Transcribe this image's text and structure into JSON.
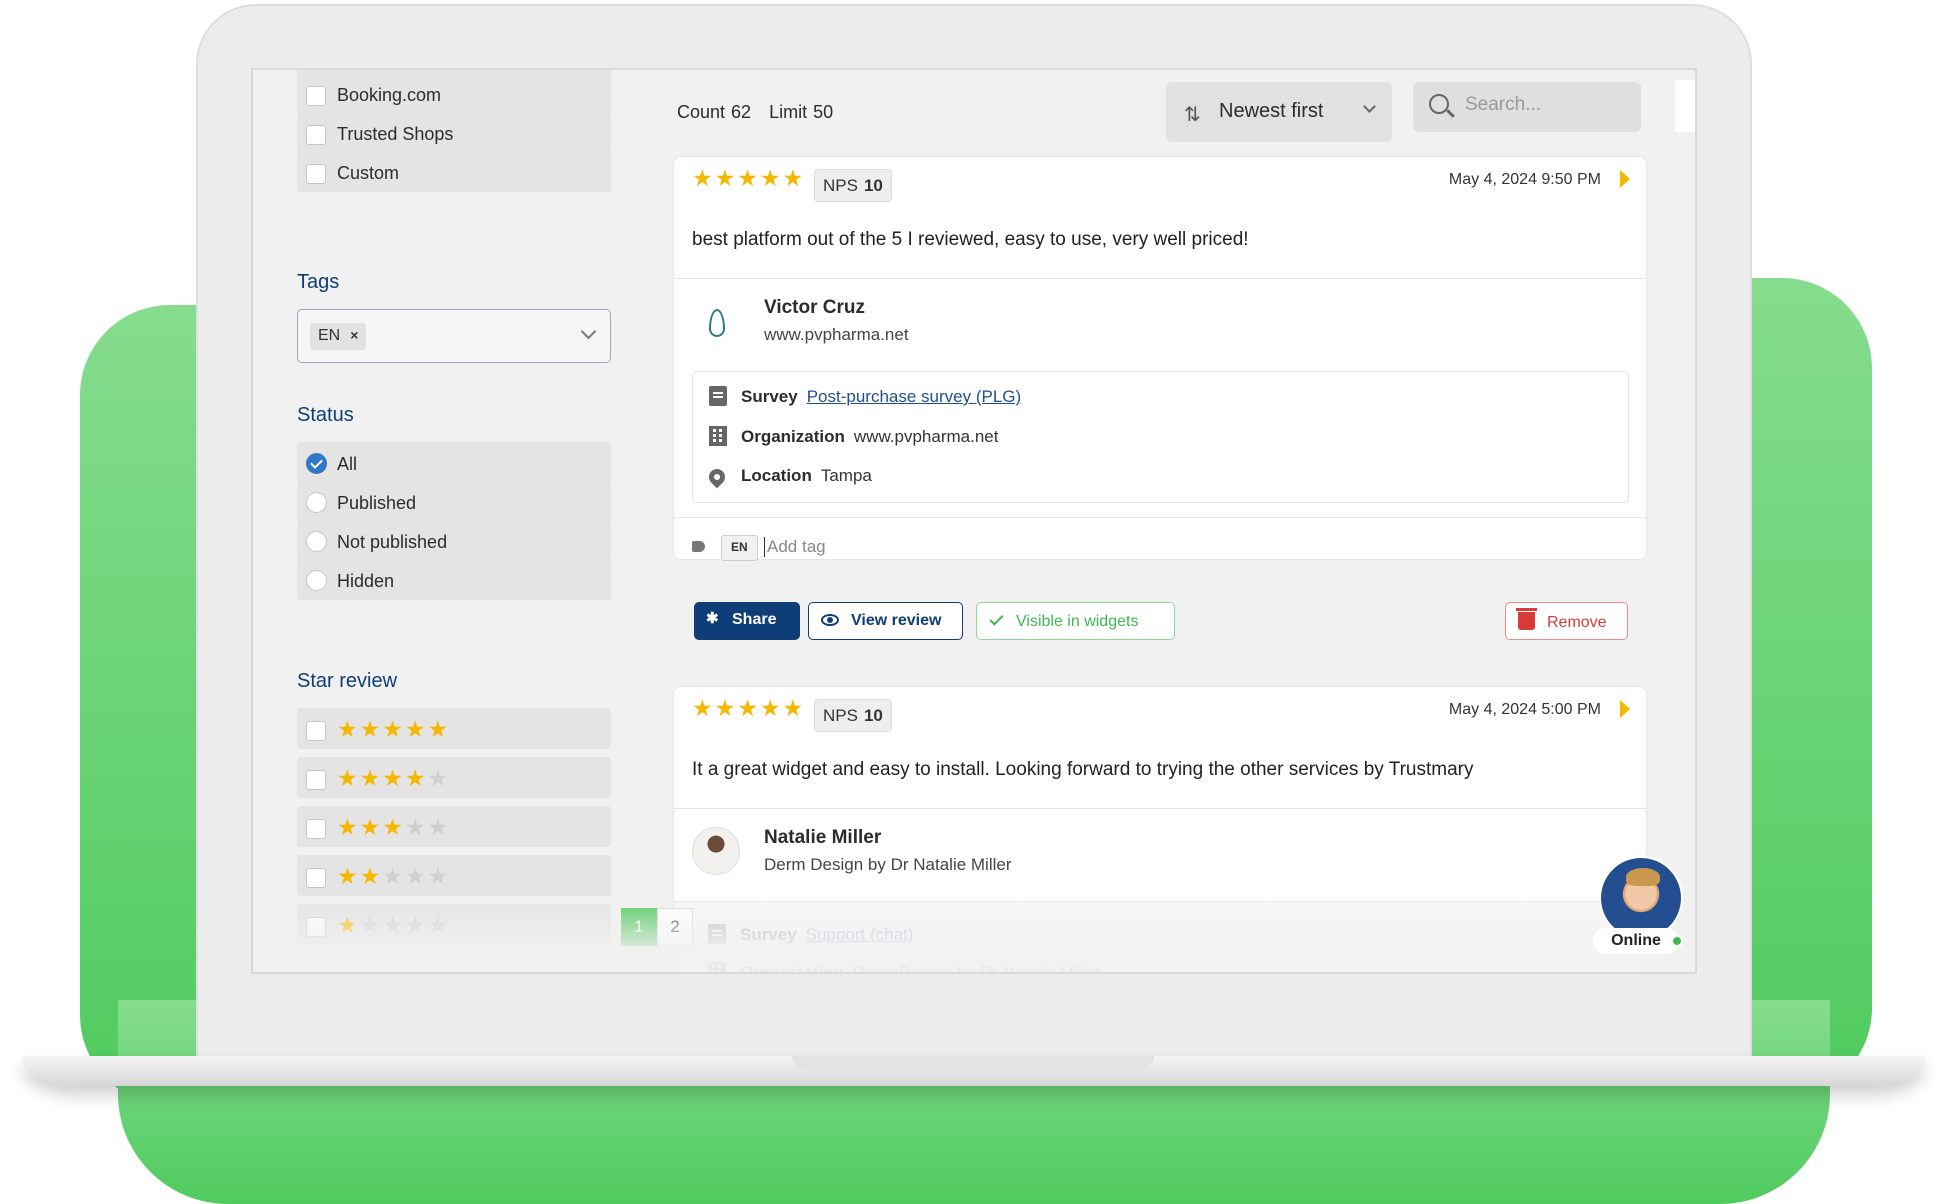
{
  "sidebar": {
    "sources": [
      {
        "label": "Booking.com",
        "checked": false
      },
      {
        "label": "Trusted Shops",
        "checked": false
      },
      {
        "label": "Custom",
        "checked": false
      }
    ],
    "tags_title": "Tags",
    "tags_selected": "EN",
    "tags_remove": "×",
    "status_title": "Status",
    "status": [
      {
        "label": "All",
        "selected": true
      },
      {
        "label": "Published",
        "selected": false
      },
      {
        "label": "Not published",
        "selected": false
      },
      {
        "label": "Hidden",
        "selected": false
      }
    ],
    "star_title": "Star review",
    "star_filters": [
      {
        "rating": 5,
        "on": "★★★★★",
        "off": ""
      },
      {
        "rating": 4,
        "on": "★★★★",
        "off": "★"
      },
      {
        "rating": 3,
        "on": "★★★",
        "off": "★★"
      },
      {
        "rating": 2,
        "on": "★★",
        "off": "★★★"
      },
      {
        "rating": 1,
        "on": "★",
        "off": "★★★★"
      }
    ]
  },
  "header": {
    "count_label": "Count",
    "count_value": "62",
    "limit_label": "Limit",
    "limit_value": "50",
    "sort_value": "Newest first",
    "search_placeholder": "Search..."
  },
  "reviews": [
    {
      "stars": "★★★★★",
      "rating": 5,
      "nps_label": "NPS",
      "nps_value": "10",
      "date": "May 4, 2024 9:50 PM",
      "text": "best platform out of the 5 I reviewed, easy to use, very well priced!",
      "name": "Victor Cruz",
      "site": "www.pvpharma.net",
      "survey_label": "Survey",
      "survey_value": "Post-purchase survey (PLG)",
      "org_label": "Organization",
      "org_value": "www.pvpharma.net",
      "loc_label": "Location",
      "loc_value": "Tampa",
      "tag": "EN",
      "add_tag_placeholder": "Add tag",
      "share": "Share",
      "view": "View review",
      "visible": "Visible in widgets",
      "remove": "Remove"
    },
    {
      "stars": "★★★★★",
      "rating": 5,
      "nps_label": "NPS",
      "nps_value": "10",
      "date": "May 4, 2024 5:00 PM",
      "text": "It a great widget and easy to install. Looking forward to trying the other services by Trustmary",
      "name": "Natalie Miller",
      "site": "Derm Design by Dr Natalie Miller",
      "survey_label": "Survey",
      "survey_value": "Support (chat)",
      "org_label": "Organization",
      "org_value": "Derm Design by Dr Natalie Miller"
    }
  ],
  "pagination": [
    "1",
    "2"
  ],
  "chat": {
    "status": "Online"
  },
  "colors": {
    "brand_navy": "#0f3d77",
    "accent_green": "#4cc75c",
    "star": "#f5b800",
    "danger": "#d93a3a"
  }
}
